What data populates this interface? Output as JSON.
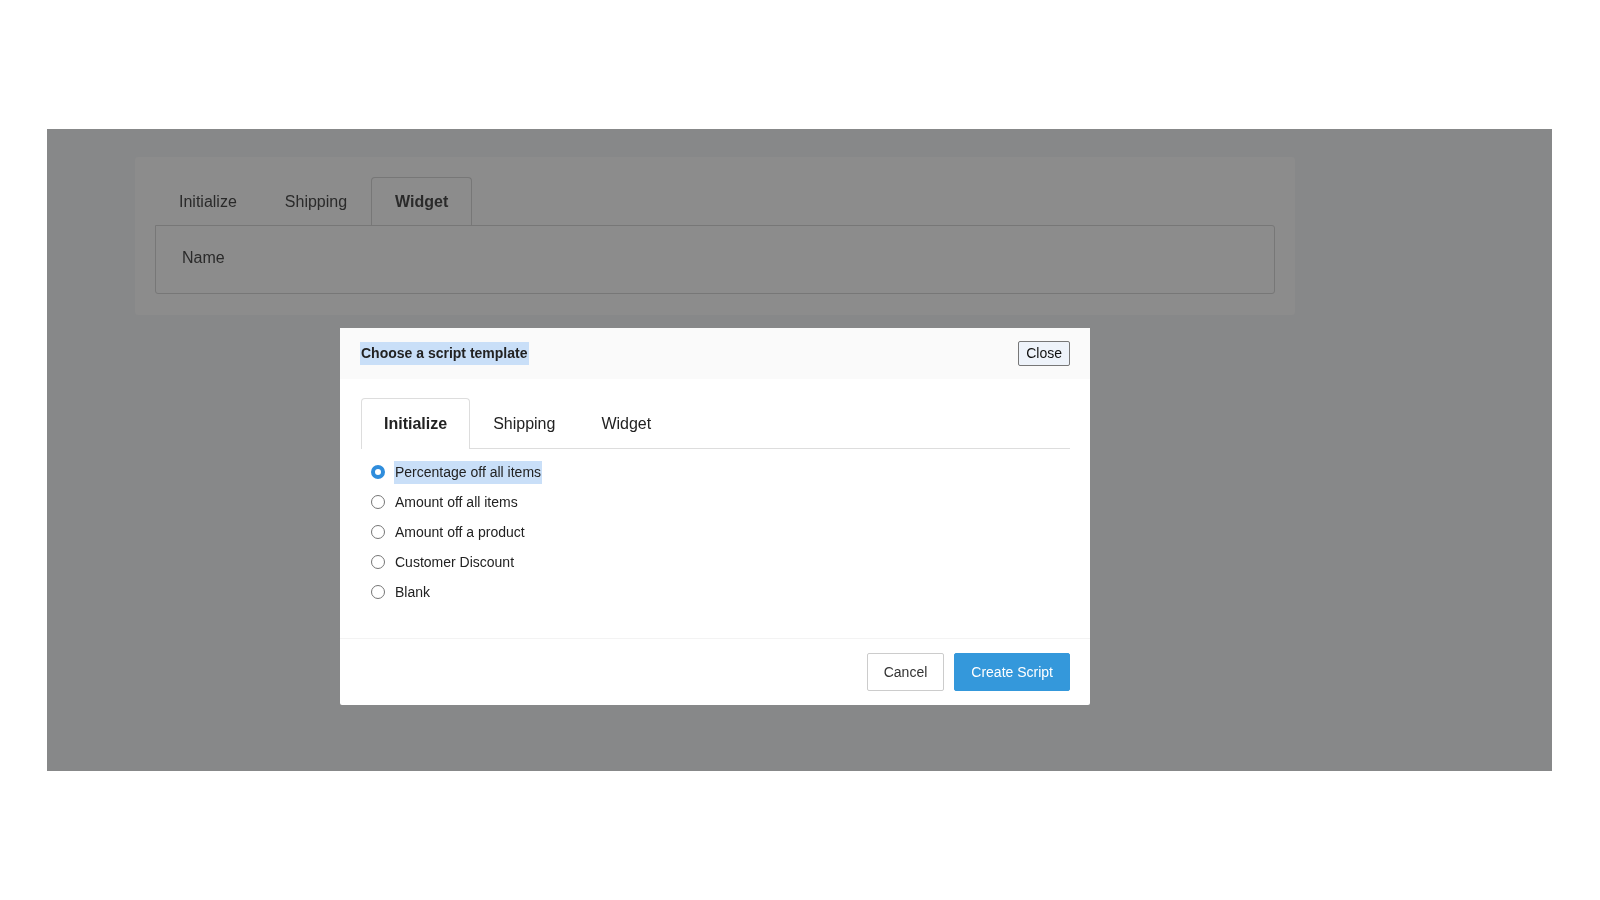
{
  "background_page": {
    "tabs": [
      {
        "label": "Initialize",
        "selected": false
      },
      {
        "label": "Shipping",
        "selected": false
      },
      {
        "label": "Widget",
        "selected": true
      }
    ],
    "panel": {
      "field_label": "Name"
    }
  },
  "modal": {
    "title": {
      "text": "Choose a script template",
      "highlighted": true
    },
    "close_button": "Close",
    "tabs": [
      {
        "label": "Initialize",
        "selected": true
      },
      {
        "label": "Shipping",
        "selected": false
      },
      {
        "label": "Widget",
        "selected": false
      }
    ],
    "options": [
      {
        "label": "Percentage off all items",
        "selected": true,
        "highlighted": true
      },
      {
        "label": "Amount off all items",
        "selected": false,
        "highlighted": false
      },
      {
        "label": "Amount off a product",
        "selected": false,
        "highlighted": false
      },
      {
        "label": "Customer Discount",
        "selected": false,
        "highlighted": false
      },
      {
        "label": "Blank",
        "selected": false,
        "highlighted": false
      }
    ],
    "buttons": [
      {
        "label": "Cancel",
        "kind": "secondary"
      },
      {
        "label": "Create Script",
        "kind": "primary"
      }
    ]
  }
}
